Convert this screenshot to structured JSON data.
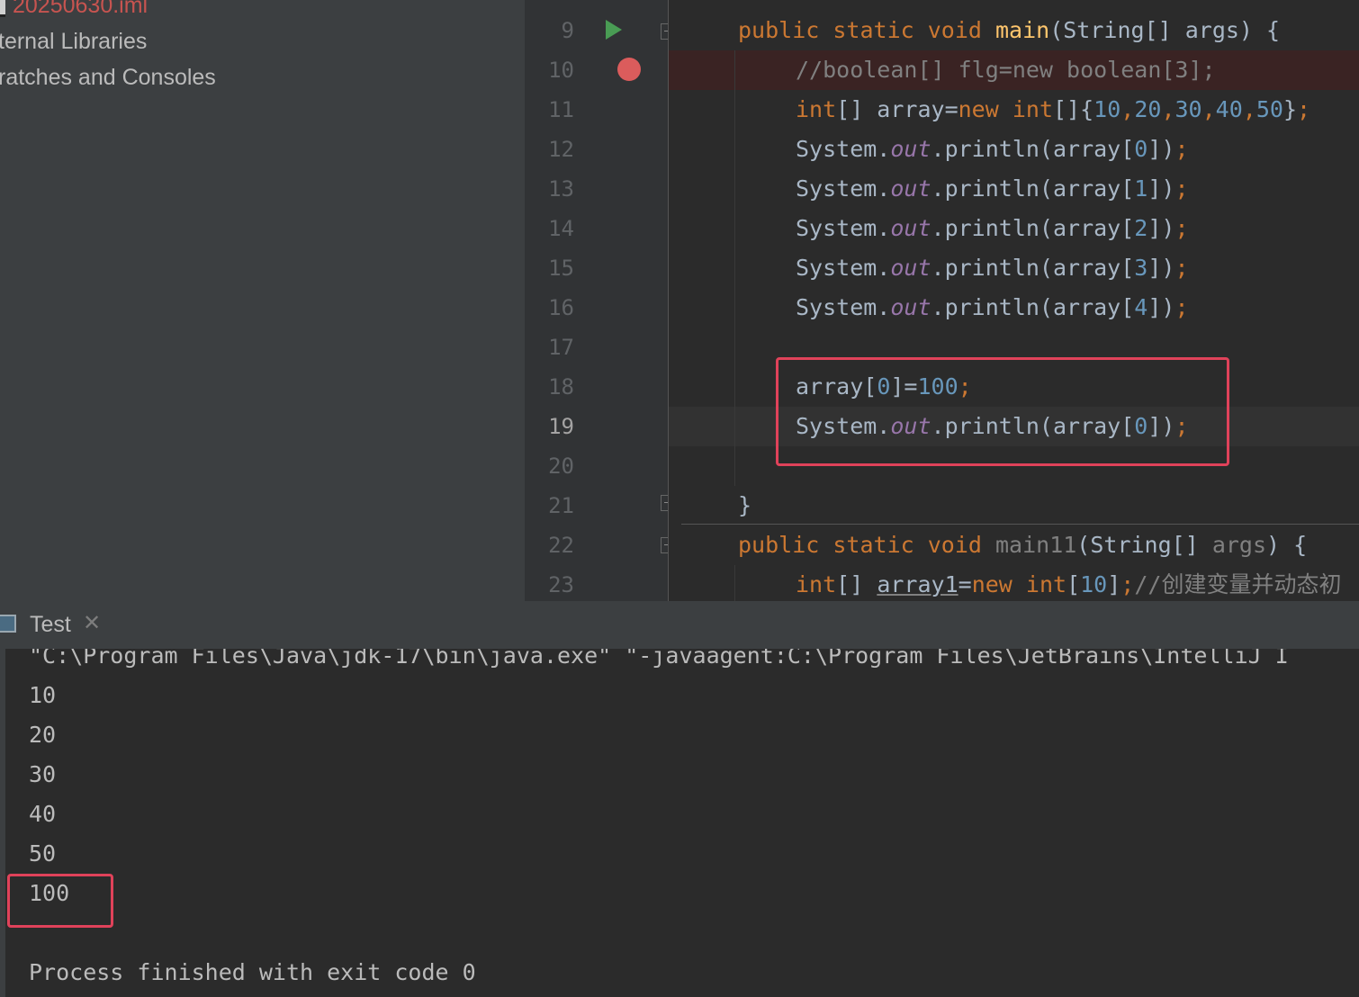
{
  "project_tree": {
    "items": [
      {
        "label": "20250630.iml"
      },
      {
        "label": "ternal Libraries"
      },
      {
        "label": "ratches and Consoles"
      }
    ]
  },
  "editor": {
    "line_numbers": [
      "9",
      "10",
      "11",
      "12",
      "13",
      "14",
      "15",
      "16",
      "17",
      "18",
      "19",
      "20",
      "21",
      "22",
      "23"
    ],
    "current_line": "19",
    "breakpoint_line": "10",
    "lines": {
      "l9": {
        "t1": "public static void ",
        "t2": "main",
        "t3": "(String[] args) {"
      },
      "l10": {
        "t1": "//boolean[] flg=new boolean[3];"
      },
      "l11": {
        "t1": "int",
        "t2": "[] array=",
        "t3": "new ",
        "t4": "int",
        "t5": "[]{",
        "t6": "10",
        "t7": ",",
        "t8": "20",
        "t9": ",",
        "t10": "30",
        "t11": ",",
        "t12": "40",
        "t13": ",",
        "t14": "50",
        "t15": "}",
        "t16": ";"
      },
      "l12": {
        "t1": "System.",
        "t2": "out",
        "t3": ".println(array[",
        "t4": "0",
        "t5": "])",
        "t6": ";"
      },
      "l13": {
        "t1": "System.",
        "t2": "out",
        "t3": ".println(array[",
        "t4": "1",
        "t5": "])",
        "t6": ";"
      },
      "l14": {
        "t1": "System.",
        "t2": "out",
        "t3": ".println(array[",
        "t4": "2",
        "t5": "])",
        "t6": ";"
      },
      "l15": {
        "t1": "System.",
        "t2": "out",
        "t3": ".println(array[",
        "t4": "3",
        "t5": "])",
        "t6": ";"
      },
      "l16": {
        "t1": "System.",
        "t2": "out",
        "t3": ".println(array[",
        "t4": "4",
        "t5": "])",
        "t6": ";"
      },
      "l18": {
        "t1": "array[",
        "t2": "0",
        "t3": "]=",
        "t4": "100",
        "t5": ";"
      },
      "l19": {
        "t1": "System.",
        "t2": "out",
        "t3": ".println(array[",
        "t4": "0",
        "t5": "])",
        "t6": ";"
      },
      "l21": {
        "t1": "}"
      },
      "l22": {
        "t1": "public static void ",
        "t2": "main11",
        "t3": "(String[] ",
        "t4": "args",
        "t5": ") {"
      },
      "l23": {
        "t1": "int",
        "t2": "[] ",
        "t3": "array1",
        "t4": "=",
        "t5": "new ",
        "t6": "int",
        "t7": "[",
        "t8": "10",
        "t9": "]",
        "t10": ";",
        "t11": "//创建变量并动态初"
      }
    }
  },
  "run_panel": {
    "tab_label": "Test",
    "close_glyph": "✕",
    "command": "\"C:\\Program Files\\Java\\jdk-17\\bin\\java.exe\" \"-javaagent:C:\\Program Files\\JetBrains\\IntelliJ I",
    "outputs": [
      "10",
      "20",
      "30",
      "40",
      "50",
      "100"
    ],
    "finish_message": "Process finished with exit code 0"
  },
  "colors": {
    "keyword": "#cc7832",
    "function": "#ffc66d",
    "number": "#6897bb",
    "static_field": "#9876aa",
    "comment": "#808080",
    "highlight_box": "#e0425a",
    "breakpoint": "#db5c5c",
    "run_arrow": "#499c54"
  },
  "icons": [
    "file-icon",
    "run-arrow-icon",
    "breakpoint-icon",
    "fold-icon",
    "console-tab-icon",
    "close-icon"
  ]
}
